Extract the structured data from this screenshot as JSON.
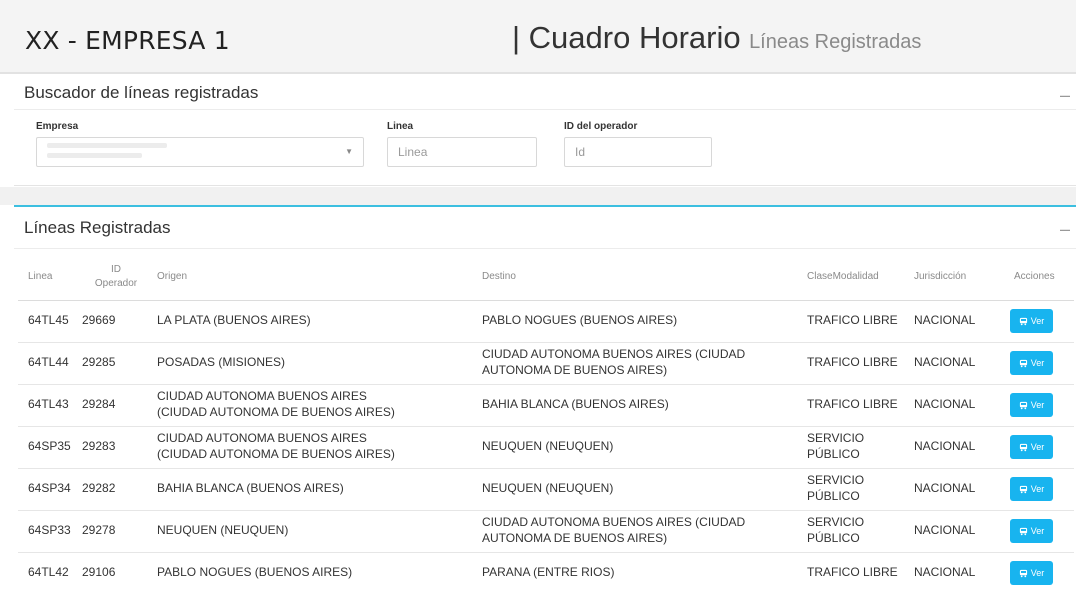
{
  "header": {
    "company": "XX - EMPRESA 1",
    "title": "| Cuadro Horario",
    "subtitle": "Líneas Registradas"
  },
  "search_panel": {
    "title": "Buscador de líneas registradas",
    "collapse_symbol": "–",
    "empresa_label": "Empresa",
    "linea_label": "Linea",
    "linea_placeholder": "Linea",
    "operator_label": "ID del operador",
    "operator_placeholder": "Id",
    "caret": "▼"
  },
  "lines_panel": {
    "title": "Líneas Registradas",
    "collapse_symbol": "–",
    "columns": {
      "linea": "Linea",
      "id_operador": "ID Operador",
      "origen": "Origen",
      "destino": "Destino",
      "clase_modalidad": "ClaseModalidad",
      "jurisdiccion": "Jurisdicción",
      "acciones": "Acciones"
    },
    "action_label": "Ver",
    "action_icon": "bus-icon",
    "rows": [
      {
        "linea": "64TL45",
        "id": "29669",
        "origen": "LA PLATA (BUENOS AIRES)",
        "destino": "PABLO NOGUES (BUENOS AIRES)",
        "clase": "TRAFICO LIBRE",
        "jurisdiccion": "NACIONAL"
      },
      {
        "linea": "64TL44",
        "id": "29285",
        "origen": "POSADAS (MISIONES)",
        "destino": "CIUDAD AUTONOMA BUENOS AIRES (CIUDAD AUTONOMA DE BUENOS AIRES)",
        "clase": "TRAFICO LIBRE",
        "jurisdiccion": "NACIONAL"
      },
      {
        "linea": "64TL43",
        "id": "29284",
        "origen": "CIUDAD AUTONOMA BUENOS AIRES (CIUDAD AUTONOMA DE BUENOS AIRES)",
        "destino": "BAHIA BLANCA (BUENOS AIRES)",
        "clase": "TRAFICO LIBRE",
        "jurisdiccion": "NACIONAL"
      },
      {
        "linea": "64SP35",
        "id": "29283",
        "origen": "CIUDAD AUTONOMA BUENOS AIRES (CIUDAD AUTONOMA DE BUENOS AIRES)",
        "destino": "NEUQUEN (NEUQUEN)",
        "clase": "SERVICIO PÚBLICO",
        "jurisdiccion": "NACIONAL"
      },
      {
        "linea": "64SP34",
        "id": "29282",
        "origen": "BAHIA BLANCA (BUENOS AIRES)",
        "destino": "NEUQUEN (NEUQUEN)",
        "clase": "SERVICIO PÚBLICO",
        "jurisdiccion": "NACIONAL"
      },
      {
        "linea": "64SP33",
        "id": "29278",
        "origen": "NEUQUEN (NEUQUEN)",
        "destino": "CIUDAD AUTONOMA BUENOS AIRES (CIUDAD AUTONOMA DE BUENOS AIRES)",
        "clase": "SERVICIO PÚBLICO",
        "jurisdiccion": "NACIONAL"
      },
      {
        "linea": "64TL42",
        "id": "29106",
        "origen": "PABLO NOGUES (BUENOS AIRES)",
        "destino": "PARANA (ENTRE RIOS)",
        "clase": "TRAFICO LIBRE",
        "jurisdiccion": "NACIONAL"
      }
    ]
  },
  "colors": {
    "accent": "#18b4ef",
    "panel_border": "#3cbfe0",
    "header_bg": "#f4f4f4"
  }
}
